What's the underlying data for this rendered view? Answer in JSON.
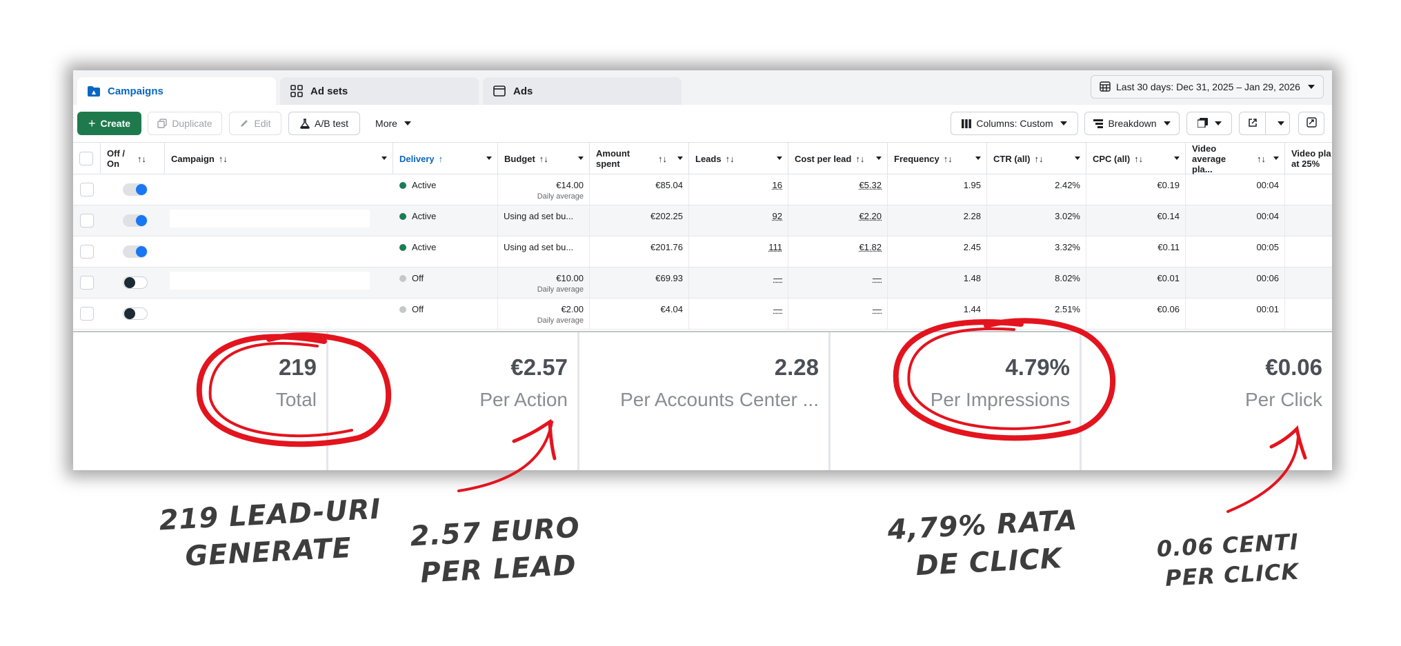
{
  "tabs": [
    {
      "label": "Campaigns",
      "icon": "folder-icon",
      "active": true
    },
    {
      "label": "Ad sets",
      "icon": "grid-icon",
      "active": false
    },
    {
      "label": "Ads",
      "icon": "ad-icon",
      "active": false
    }
  ],
  "date_range": "Last 30 days: Dec 31, 2025 – Jan 29, 2026",
  "toolbar": {
    "create": "Create",
    "duplicate": "Duplicate",
    "edit": "Edit",
    "ab_test": "A/B test",
    "more": "More",
    "columns": "Columns: Custom",
    "breakdown": "Breakdown"
  },
  "headers": {
    "offon": "Off / On",
    "campaign": "Campaign",
    "delivery": "Delivery",
    "budget": "Budget",
    "amount": "Amount spent",
    "leads": "Leads",
    "cpl": "Cost per lead",
    "freq": "Frequency",
    "ctr": "CTR (all)",
    "cpc": "CPC (all)",
    "video_avg": "Video average pla...",
    "video25": "Video pla at 25%"
  },
  "rows": [
    {
      "on": true,
      "delivery": "Active",
      "budget": "€14.00",
      "budget_sub": "Daily average",
      "amount": "€85.04",
      "leads": "16",
      "cpl": "€5.32",
      "freq": "1.95",
      "ctr": "2.42%",
      "cpc": "€0.19",
      "video": "00:04"
    },
    {
      "on": true,
      "delivery": "Active",
      "budget": "Using ad set bu...",
      "budget_sub": "",
      "amount": "€202.25",
      "leads": "92",
      "cpl": "€2.20",
      "freq": "2.28",
      "ctr": "3.02%",
      "cpc": "€0.14",
      "video": "00:04"
    },
    {
      "on": true,
      "delivery": "Active",
      "budget": "Using ad set bu...",
      "budget_sub": "",
      "amount": "€201.76",
      "leads": "111",
      "cpl": "€1.82",
      "freq": "2.45",
      "ctr": "3.32%",
      "cpc": "€0.11",
      "video": "00:05"
    },
    {
      "on": false,
      "delivery": "Off",
      "budget": "€10.00",
      "budget_sub": "Daily average",
      "amount": "€69.93",
      "leads": "—",
      "cpl": "—",
      "freq": "1.48",
      "ctr": "8.02%",
      "cpc": "€0.01",
      "video": "00:06"
    },
    {
      "on": false,
      "delivery": "Off",
      "budget": "€2.00",
      "budget_sub": "Daily average",
      "amount": "€4.04",
      "leads": "—",
      "cpl": "—",
      "freq": "1.44",
      "ctr": "2.51%",
      "cpc": "€0.06",
      "video": "00:01"
    }
  ],
  "summary": [
    {
      "value": "219",
      "label": "Total"
    },
    {
      "value": "€2.57",
      "label": "Per Action"
    },
    {
      "value": "2.28",
      "label": "Per Accounts Center ..."
    },
    {
      "value": "4.79%",
      "label": "Per Impressions"
    },
    {
      "value": "€0.06",
      "label": "Per Click"
    }
  ],
  "annotations": {
    "leads_line1": "219 lead-uri",
    "leads_line2": "generate",
    "cpl_line1": "2.57 euro",
    "cpl_line2": "per lead",
    "ctr_line1": "4,79% rata",
    "ctr_line2": "de click",
    "cpc_line1": "0.06 centi",
    "cpc_line2": "per click"
  },
  "colors": {
    "accent_blue": "#0a66c2",
    "create_green": "#1e7a4d",
    "active_dot": "#1b7c55",
    "off_dot": "#c4c7cc",
    "annotation_red": "#e3141e"
  }
}
